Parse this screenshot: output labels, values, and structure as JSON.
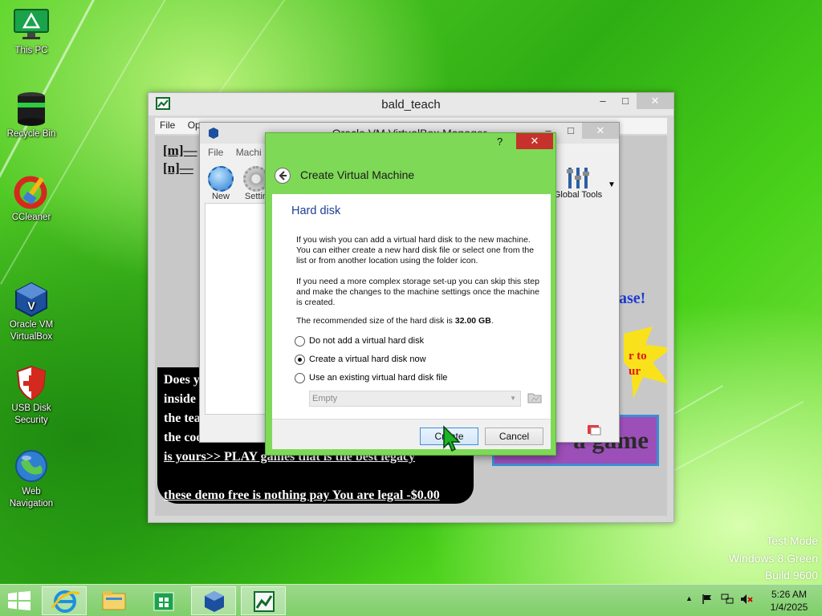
{
  "desktop": {
    "icons": [
      {
        "label": "This PC"
      },
      {
        "label": "Recycle Bin"
      },
      {
        "label": "CCleaner"
      },
      {
        "label": "Oracle VM\nVirtualBox"
      },
      {
        "label": "USB Disk\nSecurity"
      },
      {
        "label": "Web\nNavigation"
      }
    ],
    "watermark": [
      "Test Mode",
      "Windows 8.Green",
      "Build 9600"
    ]
  },
  "bald_window": {
    "title": "bald_teach",
    "menu": [
      "File",
      "Op"
    ],
    "lines_top": [
      "[m]—",
      "[n]—"
    ],
    "panel_text": [
      "Does y",
      "inside",
      "the tea",
      "the coo",
      "is yours>> PLAY games that is the best legacy",
      "these demo free is nothing pay You are legal -$0.00"
    ],
    "right_text": [
      "ase!",
      "r to",
      "ur",
      "a game"
    ]
  },
  "vbox_window": {
    "title": "Oracle VM VirtualBox Manager",
    "menu": [
      "File",
      "Machi"
    ],
    "tools": [
      {
        "label": "New"
      },
      {
        "label": "Settin"
      }
    ],
    "global_tools": "Global Tools"
  },
  "dialog": {
    "help": "?",
    "title": "Create Virtual Machine",
    "section": "Hard disk",
    "para1": "If you wish you can add a virtual hard disk to the new machine. You can either create a new hard disk file or select one from the list or from another location using the folder icon.",
    "para2": "If you need a more complex storage set-up you can skip this step and make the changes to the machine settings once the machine is created.",
    "rec_prefix": "The recommended size of the hard disk is ",
    "rec_size": "32.00 GB",
    "rec_suffix": ".",
    "options": [
      {
        "label": "Do not add a virtual hard disk",
        "selected": false
      },
      {
        "label": "Create a virtual hard disk now",
        "selected": true
      },
      {
        "label": "Use an existing virtual hard disk file",
        "selected": false
      }
    ],
    "disk_select": "Empty",
    "create_label": "Create",
    "cancel_label": "Cancel"
  },
  "taskbar": {
    "clock_time": "5:26 AM",
    "clock_date": "1/4/2025"
  },
  "colors": {
    "dialog_frame": "#7ed957",
    "close_red": "#c7312b",
    "taskbar": "#8fd67a"
  }
}
